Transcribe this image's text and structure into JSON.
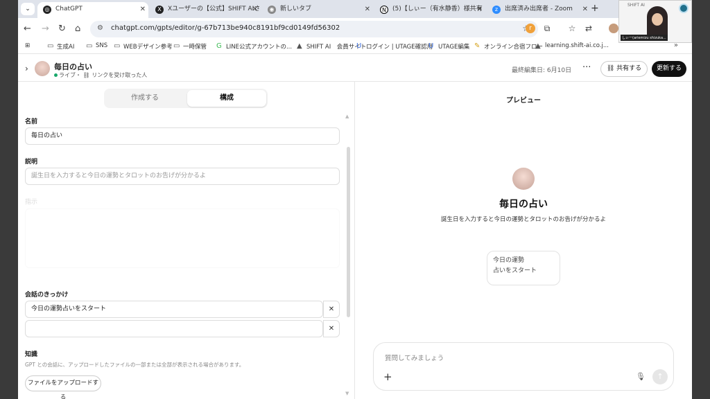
{
  "browser": {
    "tabs": [
      {
        "label": "ChatGPT",
        "active": true
      },
      {
        "label": "Xユーザーの【公式】SHIFT AIさん",
        "active": false
      },
      {
        "label": "新しいタブ",
        "active": false
      },
      {
        "label": "(5)【しぃー（有水静香）様共有",
        "active": false
      },
      {
        "label": "出席済み出席者 - Zoom",
        "active": false
      }
    ],
    "url": "chatgpt.com/gpts/editor/g-67b713be940c8191bf9cd0149fd56302",
    "bookmarks": [
      "生成AI",
      "SNS",
      "WEBデザイン参考",
      "一時保管",
      "LINE公式アカウントの...",
      "SHIFT AI　会員サイト",
      "ログイン | UTAGE確認用",
      "UTAGE編集",
      "オンライン合宿フロー",
      "learning.shift-ai.co.j..."
    ]
  },
  "zoom": {
    "brand": "SHIFT AI",
    "name": "しぃー(ariemizu shizuka..."
  },
  "header": {
    "gpt_name": "毎日の占い",
    "status": "ライブ・",
    "status_link": "リンクを受け取った人",
    "last_edited": "最終編集日: 6月10日",
    "share": "共有する",
    "update": "更新する"
  },
  "editor": {
    "tabs": [
      "作成する",
      "構成"
    ],
    "name_label": "名前",
    "name_value": "毎日の占い",
    "desc_label": "説明",
    "desc_value": "誕生日を入力すると今日の運勢とタロットのお告げが分かるよ",
    "instructions_label": "指示",
    "starters_label": "会話のきっかけ",
    "starters": [
      "今日の運勢占いをスタート",
      ""
    ],
    "knowledge_label": "知識",
    "knowledge_help": "GPT との会話に、アップロードしたファイルの一部または全部が表示される場合があります。",
    "upload_button": "ファイルをアップロードする"
  },
  "preview": {
    "title": "プレビュー",
    "name": "毎日の占い",
    "description": "誕生日を入力すると今日の運勢とタロットのお告げが分かるよ",
    "starter_card": "今日の運勢\n占いをスタート",
    "starter_line1": "今日の運勢",
    "starter_line2": "占いをスタート",
    "composer_placeholder": "質問してみましょう"
  },
  "colors": {
    "live_dot": "#18a86b",
    "update_button": "#111111",
    "tabstrip": "#dfe3eb"
  }
}
